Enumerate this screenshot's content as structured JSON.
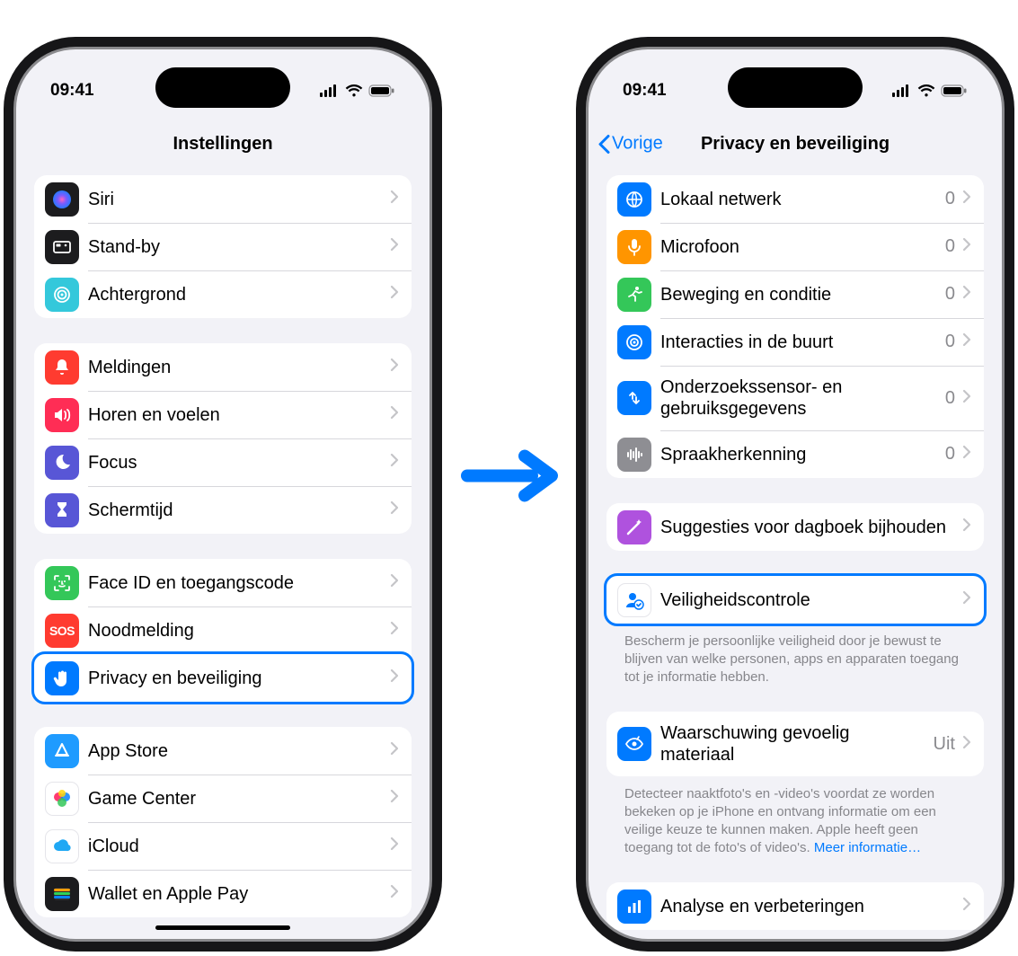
{
  "status": {
    "time": "09:41"
  },
  "screen1": {
    "title": "Instellingen",
    "groups": [
      {
        "id": "g1",
        "rows": [
          {
            "key": "siri",
            "label": "Siri",
            "icon": "siri-icon",
            "bg": "#1c1c1e"
          },
          {
            "key": "standby",
            "label": "Stand-by",
            "icon": "standby-icon",
            "bg": "#1c1c1e"
          },
          {
            "key": "wallpaper",
            "label": "Achtergrond",
            "icon": "wallpaper-icon",
            "bg": "#34c8db"
          }
        ]
      },
      {
        "id": "g2",
        "rows": [
          {
            "key": "notifications",
            "label": "Meldingen",
            "icon": "bell-icon",
            "bg": "#ff3b30"
          },
          {
            "key": "sounds",
            "label": "Horen en voelen",
            "icon": "speaker-icon",
            "bg": "#ff2d55"
          },
          {
            "key": "focus",
            "label": "Focus",
            "icon": "moon-icon",
            "bg": "#5856d6"
          },
          {
            "key": "screentime",
            "label": "Schermtijd",
            "icon": "hourglass-icon",
            "bg": "#5856d6"
          }
        ]
      },
      {
        "id": "g3",
        "rows": [
          {
            "key": "faceid",
            "label": "Face ID en toegangscode",
            "icon": "faceid-icon",
            "bg": "#34c759"
          },
          {
            "key": "sos",
            "label": "Noodmelding",
            "icon": "sos-icon",
            "bg": "#ff3b30"
          },
          {
            "key": "privacy",
            "label": "Privacy en beveiliging",
            "icon": "hand-icon",
            "bg": "#007aff",
            "highlight": true
          }
        ]
      },
      {
        "id": "g4",
        "rows": [
          {
            "key": "appstore",
            "label": "App Store",
            "icon": "appstore-icon",
            "bg": "#1f9bff"
          },
          {
            "key": "gamecenter",
            "label": "Game Center",
            "icon": "gamecenter-icon",
            "bg": "#ffffff",
            "light": true
          },
          {
            "key": "icloud",
            "label": "iCloud",
            "icon": "icloud-icon",
            "bg": "#ffffff",
            "light": true
          },
          {
            "key": "wallet",
            "label": "Wallet en Apple Pay",
            "icon": "wallet-icon",
            "bg": "#1c1c1e"
          }
        ]
      }
    ]
  },
  "screen2": {
    "title": "Privacy en beveiliging",
    "back_label": "Vorige",
    "groups": [
      {
        "id": "p1",
        "rows": [
          {
            "key": "localnet",
            "label": "Lokaal netwerk",
            "icon": "globe-icon",
            "bg": "#007aff",
            "value": "0"
          },
          {
            "key": "mic",
            "label": "Microfoon",
            "icon": "mic-icon",
            "bg": "#ff9500",
            "value": "0"
          },
          {
            "key": "motion",
            "label": "Beweging en conditie",
            "icon": "runner-icon",
            "bg": "#34c759",
            "value": "0"
          },
          {
            "key": "nearby",
            "label": "Interacties in de buurt",
            "icon": "target-icon",
            "bg": "#007aff",
            "value": "0"
          },
          {
            "key": "research",
            "label": "Onderzoekssensor- en gebruiksgegevens",
            "icon": "arrows-icon",
            "bg": "#007aff",
            "value": "0"
          },
          {
            "key": "speech",
            "label": "Spraakherkenning",
            "icon": "waveform-icon",
            "bg": "#8e8e93",
            "value": "0"
          }
        ]
      },
      {
        "id": "p2",
        "rows": [
          {
            "key": "journal",
            "label": "Suggesties voor dagboek bijhouden",
            "icon": "wand-icon",
            "bg": "#af52de"
          }
        ]
      },
      {
        "id": "p3",
        "rows": [
          {
            "key": "safety",
            "label": "Veiligheidscontrole",
            "icon": "personcheck-icon",
            "bg": "#ffffff",
            "fg": "#007aff",
            "light": true,
            "highlight": true
          }
        ],
        "footer": "Bescherm je persoonlijke veiligheid door je bewust te blijven van welke personen, apps en apparaten toegang tot je informatie hebben."
      },
      {
        "id": "p4",
        "rows": [
          {
            "key": "sensitive",
            "label": "Waarschuwing gevoelig materiaal",
            "icon": "eye-icon",
            "bg": "#007aff",
            "value": "Uit"
          }
        ],
        "footer": "Detecteer naaktfoto's en -video's voordat ze worden bekeken op je iPhone en ontvang informatie om een veilige keuze te kunnen maken. Apple heeft geen toegang tot de foto's of video's.",
        "footer_link": "Meer informatie…"
      },
      {
        "id": "p5",
        "rows": [
          {
            "key": "analytics",
            "label": "Analyse en verbeteringen",
            "icon": "barchart-icon",
            "bg": "#007aff"
          }
        ]
      }
    ]
  }
}
